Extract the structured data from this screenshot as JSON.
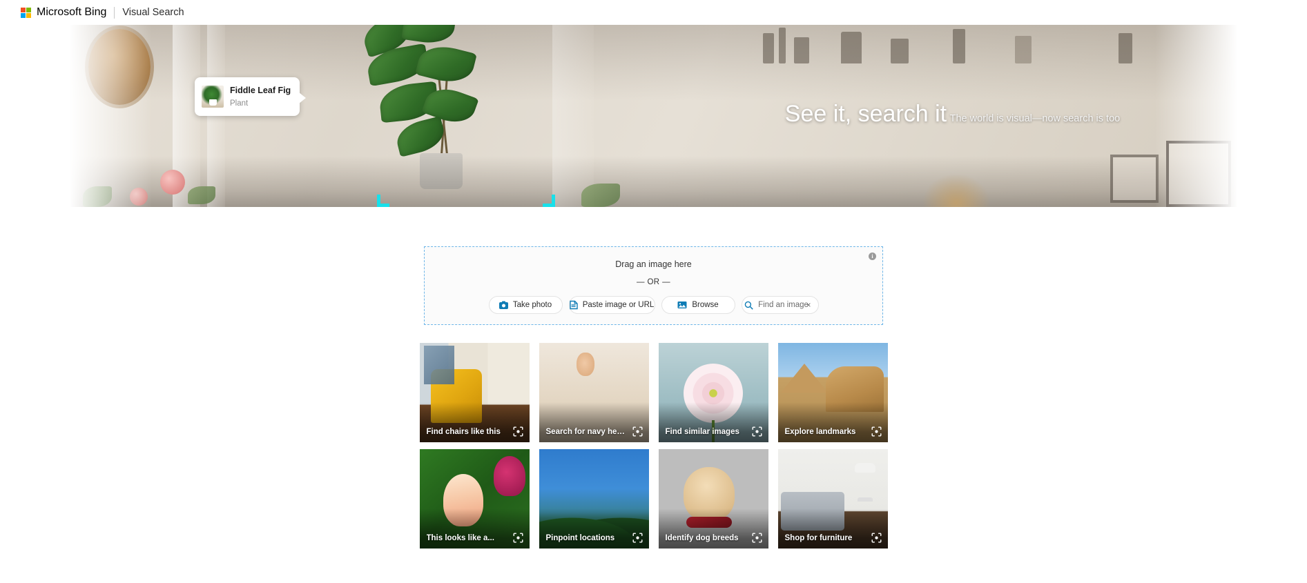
{
  "header": {
    "logo_icon": "microsoft-squares-icon",
    "brand": "Microsoft Bing",
    "section": "Visual Search"
  },
  "hero": {
    "title": "See it, search it",
    "tagline": "The world is visual—now search is too",
    "object_tag": {
      "title": "Fiddle Leaf Fig",
      "subtitle": "Plant",
      "thumb_icon": "plant-thumbnail"
    },
    "selection_bracket_color": "#18e0ea"
  },
  "dropzone": {
    "drag_text": "Drag an image here",
    "or_text": "— OR —",
    "info_icon": "info-icon",
    "info_glyph": "i",
    "border_color": "#6cb5e8",
    "buttons": [
      {
        "label": "Take photo",
        "icon": "camera-icon"
      },
      {
        "label": "Paste image or URL",
        "icon": "paste-document-icon"
      },
      {
        "label": "Browse",
        "icon": "image-file-icon"
      },
      {
        "label": "Find an image",
        "icon": "search-icon",
        "clear_icon": "close-icon",
        "clear_glyph": "×"
      }
    ],
    "icon_color": "#0f7cb5"
  },
  "tiles": [
    {
      "caption": "Find chairs like this",
      "icon": "visual-search-icon",
      "scene": "sc-chair"
    },
    {
      "caption": "Search for navy heels",
      "icon": "visual-search-icon",
      "scene": "sc-heels"
    },
    {
      "caption": "Find similar images",
      "icon": "visual-search-icon",
      "scene": "sc-flower"
    },
    {
      "caption": "Explore landmarks",
      "icon": "visual-search-icon",
      "scene": "sc-sphinx"
    },
    {
      "caption": "This looks like a...",
      "icon": "visual-search-icon",
      "scene": "sc-tulip"
    },
    {
      "caption": "Pinpoint locations",
      "icon": "visual-search-icon",
      "scene": "sc-temple"
    },
    {
      "caption": "Identify dog breeds",
      "icon": "visual-search-icon",
      "scene": "sc-puppy"
    },
    {
      "caption": "Shop for furniture",
      "icon": "visual-search-icon",
      "scene": "sc-sofa"
    }
  ]
}
